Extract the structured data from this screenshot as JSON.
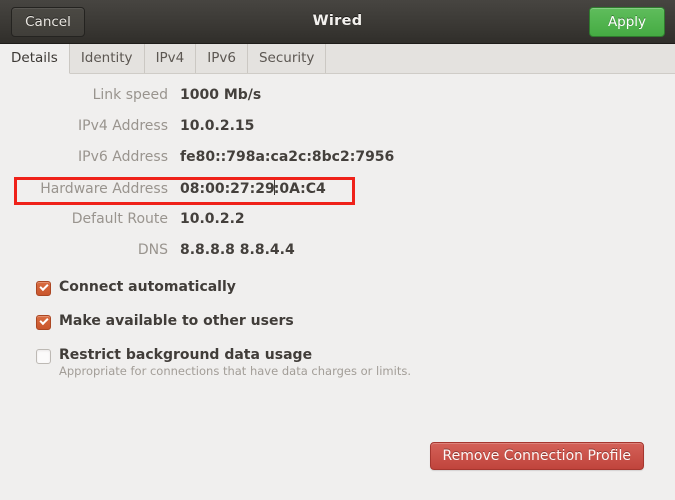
{
  "titlebar": {
    "title": "Wired",
    "cancel_label": "Cancel",
    "apply_label": "Apply"
  },
  "tabs": [
    {
      "label": "Details",
      "active": true
    },
    {
      "label": "Identity",
      "active": false
    },
    {
      "label": "IPv4",
      "active": false
    },
    {
      "label": "IPv6",
      "active": false
    },
    {
      "label": "Security",
      "active": false
    }
  ],
  "details": {
    "rows": [
      {
        "label": "Link speed",
        "value": "1000 Mb/s",
        "highlighted": false
      },
      {
        "label": "IPv4 Address",
        "value": "10.0.2.15",
        "highlighted": false
      },
      {
        "label": "IPv6 Address",
        "value": "fe80::798a:ca2c:8bc2:7956",
        "highlighted": false
      },
      {
        "label": "Hardware Address",
        "value": "08:00:27:29:0A:C4",
        "highlighted": true,
        "caret_after": 11
      },
      {
        "label": "Default Route",
        "value": "10.0.2.2",
        "highlighted": false
      },
      {
        "label": "DNS",
        "value": "8.8.8.8 8.8.4.4",
        "highlighted": false
      }
    ]
  },
  "options": [
    {
      "title": "Connect automatically",
      "subtitle": "",
      "checked": true
    },
    {
      "title": "Make available to other users",
      "subtitle": "",
      "checked": true
    },
    {
      "title": "Restrict background data usage",
      "subtitle": "Appropriate for connections that have data charges or limits.",
      "checked": false
    }
  ],
  "actions": {
    "remove_label": "Remove Connection Profile"
  },
  "colors": {
    "accent_green": "#4caf50",
    "accent_orange": "#c9552c",
    "accent_red": "#c0443c",
    "annotation_red": "#ef2119",
    "titlebar_dark": "#3b3935",
    "background": "#f0efee"
  }
}
